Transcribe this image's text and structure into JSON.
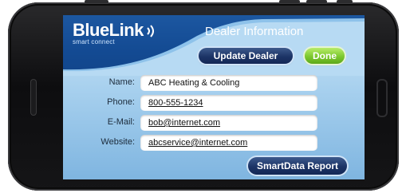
{
  "app": {
    "logo_text": "BlueLink",
    "logo_tagline": "smart connect",
    "title": "Dealer Information"
  },
  "toolbar": {
    "update_label": "Update Dealer",
    "done_label": "Done"
  },
  "form": {
    "fields": [
      {
        "label": "Name:",
        "value": "ABC Heating & Cooling"
      },
      {
        "label": "Phone:",
        "value": "800-555-1234"
      },
      {
        "label": "E-Mail:",
        "value": "bob@internet.com"
      },
      {
        "label": "Website:",
        "value": "abcservice@internet.com"
      }
    ]
  },
  "actions": {
    "report_label": "SmartData Report"
  },
  "colors": {
    "header_blue": "#1a5aa8",
    "button_navy": "#1c3466",
    "done_green": "#7cc82e",
    "screen_bg": "#a7d0ee"
  },
  "icons": {
    "logo_signal": "wireless-waves-icon"
  }
}
